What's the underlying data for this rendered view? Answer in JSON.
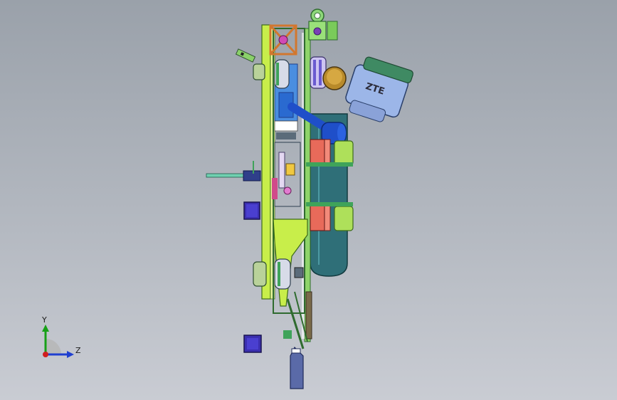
{
  "triad": {
    "y_label": "Y",
    "z_label": "Z"
  },
  "motor": {
    "logo": "ZTE"
  },
  "colors": {
    "background_top": "#9aa1aa",
    "background_bottom": "#c9ccd3",
    "plate_green": "#b8e04a",
    "frame_dark": "#2f6b2f",
    "tank_teal": "#2f6f78",
    "clamp_red": "#e86a5a",
    "clamp_lime": "#aee05a",
    "roller_blue": "#1f4fc9",
    "motor_body": "#9cb6e8",
    "motor_cap": "#3f8a63",
    "gold_disc": "#b88a2a",
    "cube_violet": "#3b2fb0",
    "tool_tip": "#5a6aa8"
  }
}
